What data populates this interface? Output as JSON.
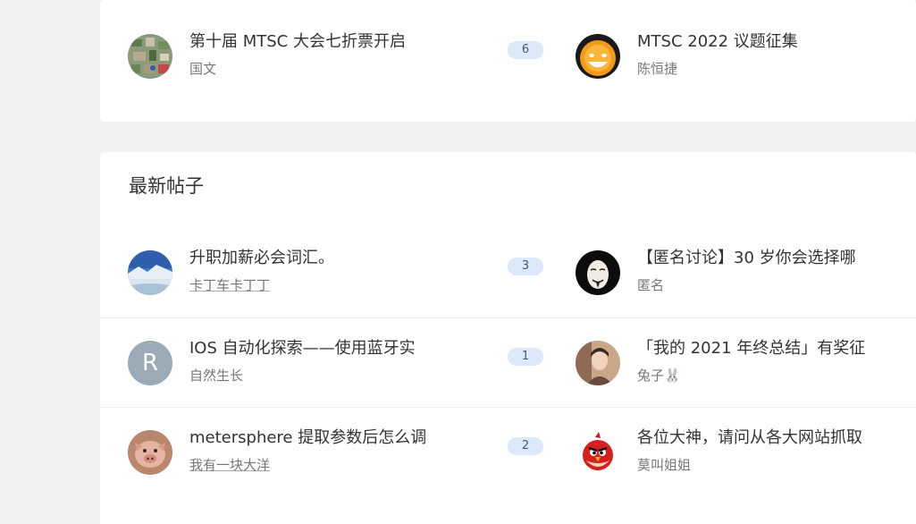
{
  "top_section": {
    "rows": [
      {
        "left": {
          "title": "第十届 MTSC 大会七折票开启",
          "author": "国文",
          "replies": "6",
          "avatar": "map-avatar"
        },
        "right": {
          "title": "MTSC 2022 议题征集",
          "author": "陈恒捷",
          "avatar": "orange-face-avatar"
        }
      }
    ]
  },
  "latest_section": {
    "title": "最新帖子",
    "rows": [
      {
        "left": {
          "title": "升职加薪必会词汇。",
          "author": "卡丁车卡丁丁",
          "replies": "3",
          "avatar": "landscape-avatar"
        },
        "right": {
          "title": "【匿名讨论】30 岁你会选择哪",
          "author": "匿名",
          "avatar": "mask-avatar"
        }
      },
      {
        "left": {
          "title": "IOS 自动化探索——使用蓝牙实",
          "author": "自然生长",
          "replies": "1",
          "avatar": "letter-avatar",
          "avatar_letter": "R"
        },
        "right": {
          "title": "「我的 2021 年终总结」有奖征",
          "author": "兔子🐰",
          "avatar": "person-avatar"
        }
      },
      {
        "left": {
          "title": "metersphere 提取参数后怎么调",
          "author": "我有一块大洋",
          "replies": "2",
          "avatar": "pig-avatar"
        },
        "right": {
          "title": "各位大神，请问从各大网站抓取",
          "author": "莫叫姐姐",
          "avatar": "angry-bird-avatar"
        }
      }
    ]
  },
  "colors": {
    "page_bg": "#f2f2f2",
    "card_bg": "#ffffff",
    "badge_bg": "#dce9fb",
    "letter_avatar_bg": "#9aaab6"
  }
}
